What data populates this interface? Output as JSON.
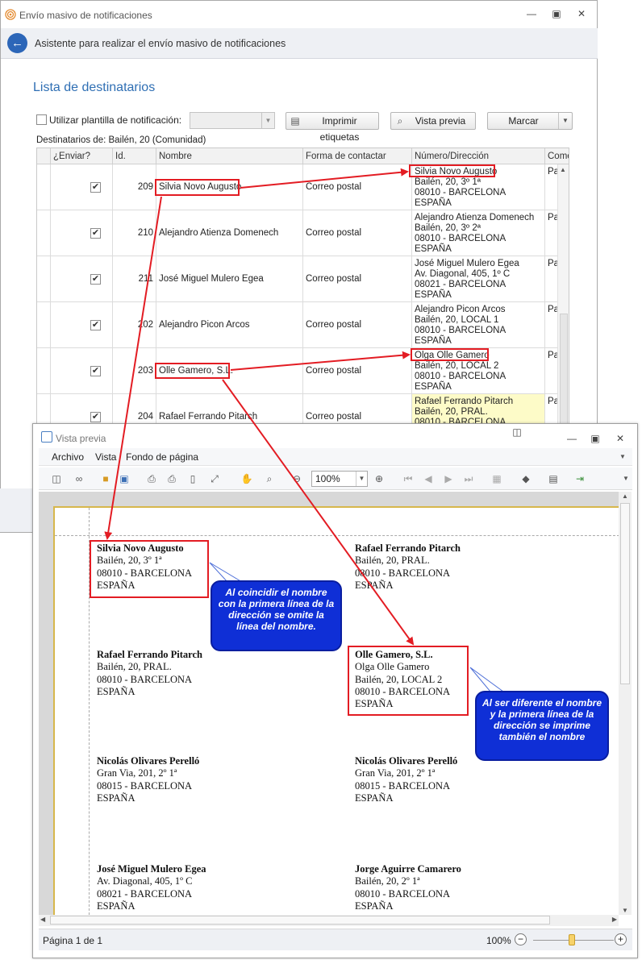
{
  "main_window": {
    "title": "Envío masivo de notificaciones",
    "wizard_text": "Asistente para realizar el envío masivo de notificaciones",
    "section_title": "Lista de destinatarios",
    "use_template_label": "Utilizar plantilla de notificación:",
    "buttons": {
      "print_labels": "Imprimir etiquetas",
      "preview": "Vista previa",
      "mark": "Marcar"
    },
    "recipients_label": "Destinatarios de: Bailén, 20 (Comunidad)",
    "columns": [
      "¿Enviar?",
      "Id.",
      "Nombre",
      "Forma de contactar",
      "Número/Dirección",
      "Come"
    ],
    "rows": [
      {
        "send": true,
        "id": "209",
        "name": "Silvia Novo Augusto",
        "contact": "Correo postal",
        "address": [
          "Silvia Novo Augusto",
          "Bailén, 20, 3º 1ª",
          "08010 - BARCELONA",
          "ESPAÑA"
        ],
        "comment": "Pa"
      },
      {
        "send": true,
        "id": "210",
        "name": "Alejandro Atienza Domenech",
        "contact": "Correo postal",
        "address": [
          "Alejandro Atienza Domenech",
          "Bailén, 20, 3º 2ª",
          "08010 - BARCELONA",
          "ESPAÑA"
        ],
        "comment": "Pa"
      },
      {
        "send": true,
        "id": "211",
        "name": "José Miguel Mulero Egea",
        "contact": "Correo postal",
        "address": [
          "José Miguel Mulero Egea",
          "Av. Diagonal, 405, 1º C",
          "08021 - BARCELONA",
          "ESPAÑA"
        ],
        "comment": "Pa"
      },
      {
        "send": true,
        "id": "202",
        "name": "Alejandro Picon Arcos",
        "contact": "Correo postal",
        "address": [
          "Alejandro Picon Arcos",
          "Bailén, 20, LOCAL 1",
          "08010 - BARCELONA",
          "ESPAÑA"
        ],
        "comment": "Pa"
      },
      {
        "send": true,
        "id": "203",
        "name": "Olle Gamero, S.L.",
        "contact": "Correo postal",
        "address": [
          "Olga Olle Gamero",
          "Bailén, 20, LOCAL 2",
          "08010 - BARCELONA",
          "ESPAÑA"
        ],
        "comment": "Pa"
      },
      {
        "send": true,
        "id": "204",
        "name": "Rafael Ferrando Pitarch",
        "contact": "Correo postal",
        "address": [
          "Rafael Ferrando Pitarch",
          "Bailén, 20, PRAL.",
          "08010 - BARCELONA",
          ""
        ],
        "comment": "Pa"
      }
    ]
  },
  "preview_window": {
    "title": "Vista previa",
    "menu": [
      "Archivo",
      "Vista",
      "Fondo de página"
    ],
    "zoom_value": "100%",
    "labels": [
      {
        "name": "Silvia Novo Augusto",
        "lines": [
          "Bailén, 20, 3º 1ª",
          "08010 - BARCELONA",
          "ESPAÑA"
        ]
      },
      {
        "name": "Rafael Ferrando Pitarch",
        "lines": [
          "Bailén, 20, PRAL.",
          "08010 - BARCELONA",
          "ESPAÑA"
        ]
      },
      {
        "name": "Rafael Ferrando Pitarch",
        "lines": [
          "Bailén, 20, PRAL.",
          "08010 - BARCELONA",
          "ESPAÑA"
        ]
      },
      {
        "name": "Olle Gamero, S.L.",
        "lines": [
          "Olga Olle Gamero",
          "Bailén, 20, LOCAL 2",
          "08010 - BARCELONA",
          "ESPAÑA"
        ]
      },
      {
        "name": "Nicolás Olivares Perelló",
        "lines": [
          "Gran Via, 201, 2º 1ª",
          "08015 - BARCELONA",
          "ESPAÑA"
        ]
      },
      {
        "name": "Nicolás Olivares Perelló",
        "lines": [
          "Gran Via, 201, 2º 1ª",
          "08015 - BARCELONA",
          "ESPAÑA"
        ]
      },
      {
        "name": "José Miguel Mulero Egea",
        "lines": [
          "Av. Diagonal, 405, 1º C",
          "08021 - BARCELONA",
          "ESPAÑA"
        ]
      },
      {
        "name": "Jorge Aguirre Camarero",
        "lines": [
          "Bailén, 20, 2º 1ª",
          "08010 - BARCELONA",
          "ESPAÑA"
        ]
      }
    ],
    "status_page": "Página 1 de 1",
    "status_zoom": "100%"
  },
  "annotations": {
    "callout_same": "Al coincidir el nombre con la primera línea de la dirección se omite la línea del nombre.",
    "callout_diff": "Al ser diferente el nombre y la primera línea de la dirección se imprime también el nombre"
  },
  "colors": {
    "accent": "#2f6fb4",
    "annotation_red": "#e31c23",
    "callout_blue": "#0f2fd6",
    "highlight": "#fdfbc8"
  }
}
